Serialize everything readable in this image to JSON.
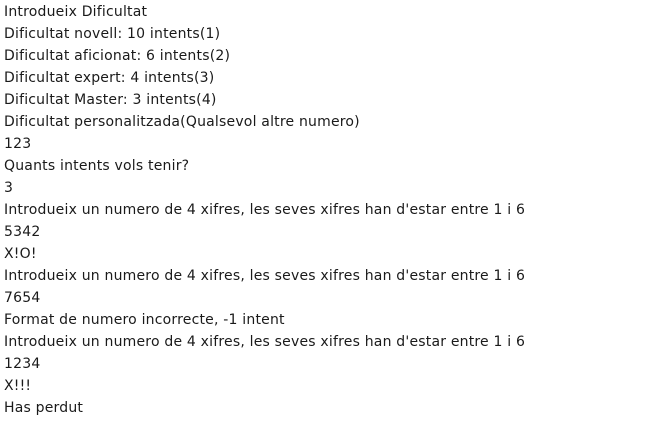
{
  "console": {
    "lines": [
      {
        "name": "prompt-difficulty",
        "text": "Introdueix Dificultat"
      },
      {
        "name": "option-novell",
        "text": "Dificultat novell: 10 intents(1)"
      },
      {
        "name": "option-aficionat",
        "text": "Dificultat aficionat: 6 intents(2)"
      },
      {
        "name": "option-expert",
        "text": "Dificultat expert: 4 intents(3)"
      },
      {
        "name": "option-master",
        "text": "Dificultat Master: 3 intents(4)"
      },
      {
        "name": "option-personalitzada",
        "text": "Dificultat personalitzada(Qualsevol altre numero)"
      },
      {
        "name": "user-input-difficulty",
        "text": "123"
      },
      {
        "name": "prompt-attempts",
        "text": "Quants intents vols tenir?"
      },
      {
        "name": "user-input-attempts",
        "text": "3"
      },
      {
        "name": "prompt-number-1",
        "text": "Introdueix un numero de 4 xifres, les seves xifres han d'estar entre 1 i 6"
      },
      {
        "name": "user-input-guess-1",
        "text": "5342"
      },
      {
        "name": "result-guess-1",
        "text": "X!O!"
      },
      {
        "name": "prompt-number-2",
        "text": "Introdueix un numero de 4 xifres, les seves xifres han d'estar entre 1 i 6"
      },
      {
        "name": "user-input-guess-2",
        "text": "7654"
      },
      {
        "name": "error-format",
        "text": "Format de numero incorrecte, -1 intent"
      },
      {
        "name": "prompt-number-3",
        "text": "Introdueix un numero de 4 xifres, les seves xifres han d'estar entre 1 i 6"
      },
      {
        "name": "user-input-guess-3",
        "text": "1234"
      },
      {
        "name": "result-guess-3",
        "text": "X!!!"
      },
      {
        "name": "game-over-message",
        "text": "Has perdut"
      }
    ]
  }
}
